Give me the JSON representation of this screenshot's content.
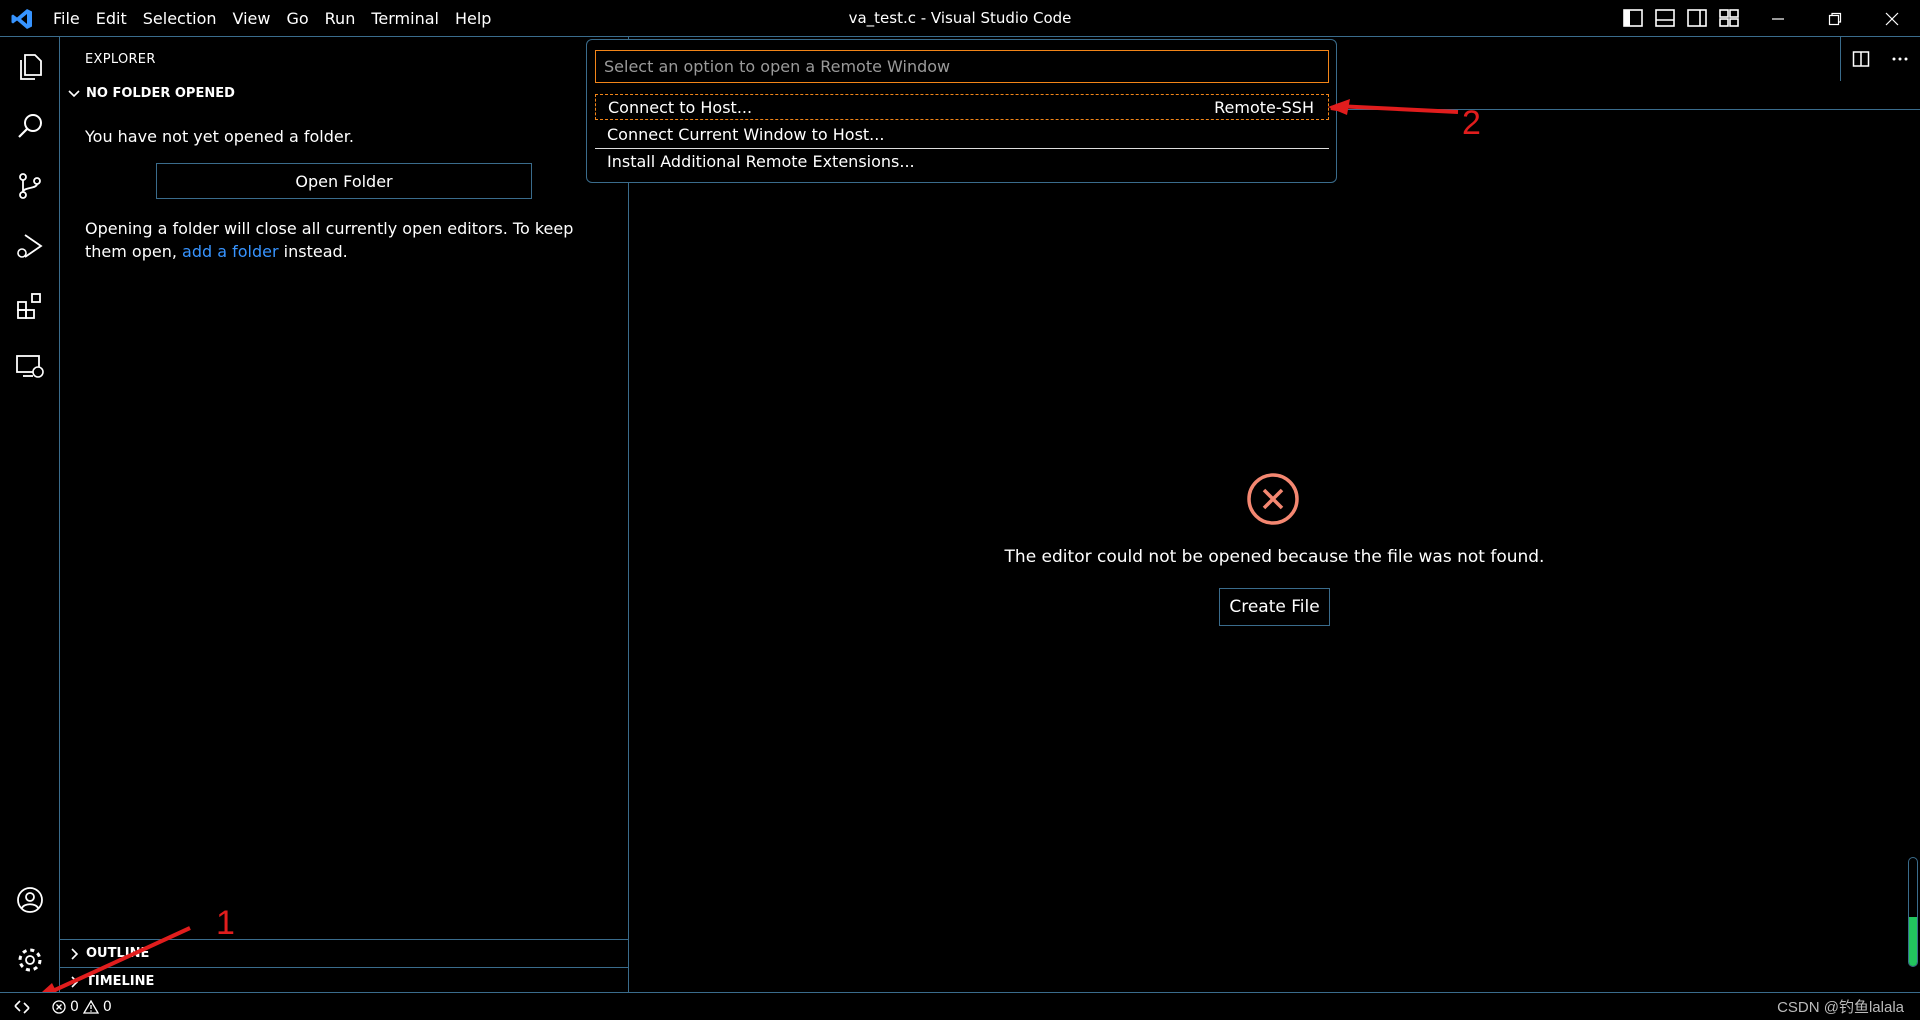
{
  "window": {
    "title": "va_test.c - Visual Studio Code"
  },
  "menu": [
    "File",
    "Edit",
    "Selection",
    "View",
    "Go",
    "Run",
    "Terminal",
    "Help"
  ],
  "sidebar": {
    "title": "EXPLORER",
    "folder_section": "NO FOLDER OPENED",
    "message": "You have not yet opened a folder.",
    "open_folder_label": "Open Folder",
    "note_before": "Opening a folder will close all currently open editors. To keep them open, ",
    "note_link": "add a folder",
    "note_after": " instead.",
    "outline_label": "OUTLINE",
    "timeline_label": "TIMELINE"
  },
  "quick_pick": {
    "placeholder": "Select an option to open a Remote Window",
    "items": [
      {
        "label": "Connect to Host...",
        "detail": "Remote-SSH"
      },
      {
        "label": "Connect Current Window to Host...",
        "detail": ""
      },
      {
        "label": "Install Additional Remote Extensions...",
        "detail": ""
      }
    ]
  },
  "editor": {
    "error_message": "The editor could not be opened because the file was not found.",
    "create_file_label": "Create File"
  },
  "statusbar": {
    "errors": "0",
    "warnings": "0",
    "watermark": "CSDN @钓鱼lalala"
  },
  "annotations": [
    "1",
    "2"
  ],
  "colors": {
    "accent": "#3a6c8c",
    "focus": "#f38518",
    "link": "#3794ff",
    "error": "#f48771",
    "annotation": "#e11d1d"
  }
}
